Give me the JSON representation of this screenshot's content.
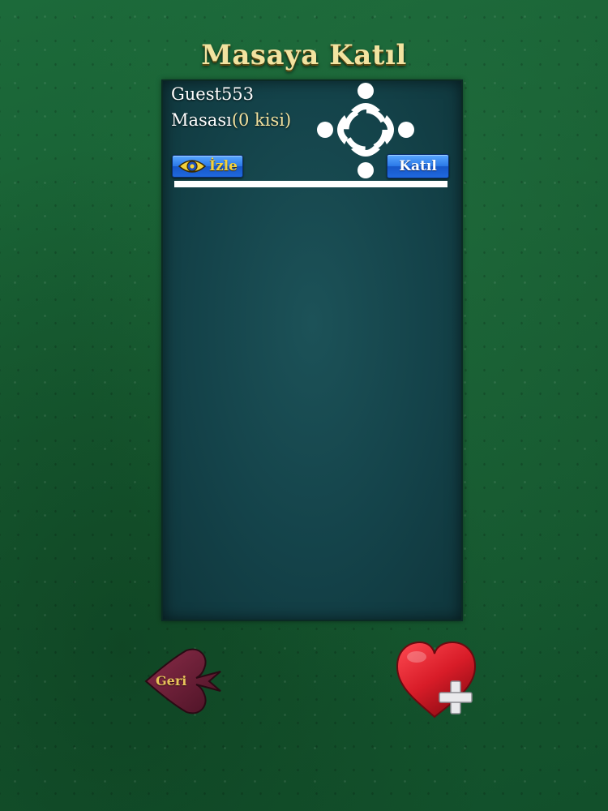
{
  "screen": {
    "title": "Masaya Katıl"
  },
  "tables": [
    {
      "host": "Guest553",
      "table_label": "Masası",
      "player_count": "(0 kisi)",
      "watch_label": "İzle",
      "join_label": "Katıl",
      "seats_icon": "four-player-table-icon"
    }
  ],
  "footer": {
    "back_label": "Geri",
    "back_icon": "spade-icon",
    "create_icon": "heart-plus-icon"
  },
  "colors": {
    "felt": "#175c31",
    "panel": "#14434a",
    "title": "#f2e3a0",
    "button": "#2a78e8",
    "spade": "#6a1f33",
    "heart": "#d81c28"
  }
}
